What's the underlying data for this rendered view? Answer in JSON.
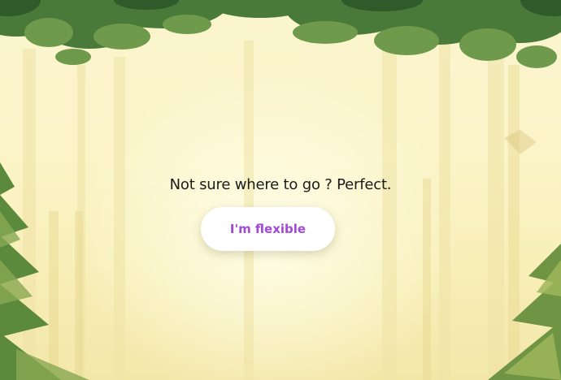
{
  "hero": {
    "tagline": "Not sure where to go ? Perfect.",
    "button_label": "I'm flexible",
    "button_text_color": "#a24ad6",
    "background_color": "#fbf5cf"
  }
}
